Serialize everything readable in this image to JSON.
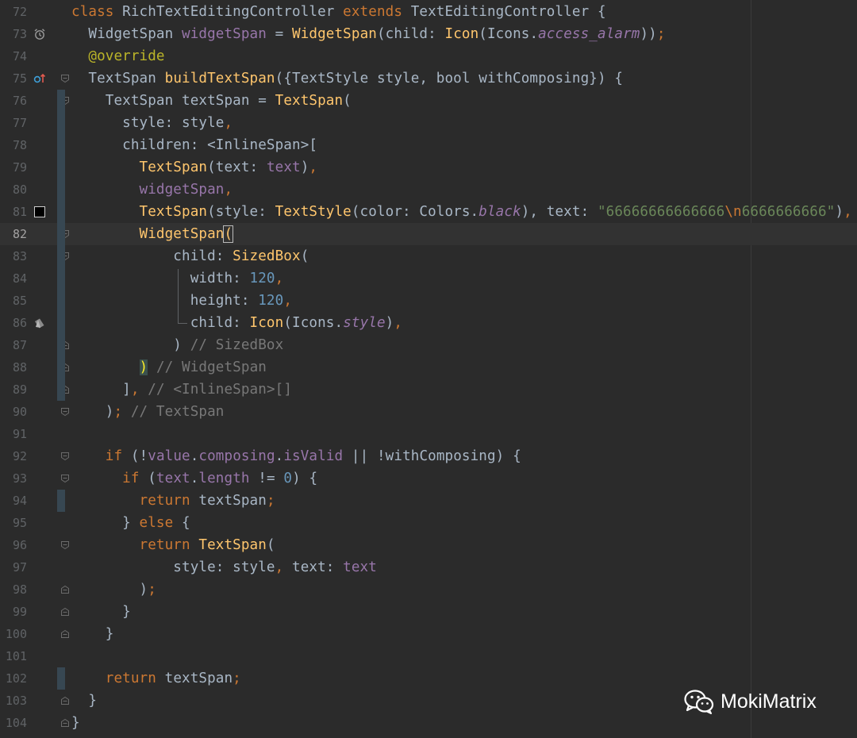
{
  "editor": {
    "lines": [
      {
        "num": "72",
        "tokens": [
          [
            "kw",
            "class "
          ],
          [
            "typ",
            "RichTextEditingController "
          ],
          [
            "kw",
            "extends "
          ],
          [
            "typ",
            "TextEditingController {"
          ]
        ]
      },
      {
        "num": "73",
        "tokens": [
          [
            "typ",
            "  WidgetSpan "
          ],
          [
            "fld",
            "widgetSpan"
          ],
          [
            "typ",
            " = "
          ],
          [
            "cls",
            "WidgetSpan"
          ],
          [
            "typ",
            "(child: "
          ],
          [
            "cls",
            "Icon"
          ],
          [
            "typ",
            "(Icons."
          ],
          [
            "ital",
            "access_alarm"
          ],
          [
            "typ",
            "))"
          ],
          [
            "kw",
            ";"
          ]
        ]
      },
      {
        "num": "74",
        "tokens": [
          [
            "ann",
            "  @override"
          ]
        ]
      },
      {
        "num": "75",
        "tokens": [
          [
            "typ",
            "  TextSpan "
          ],
          [
            "cls",
            "buildTextSpan"
          ],
          [
            "typ",
            "({TextStyle style, bool withComposing}) {"
          ]
        ]
      },
      {
        "num": "76",
        "tokens": [
          [
            "typ",
            "    TextSpan textSpan = "
          ],
          [
            "cls",
            "TextSpan"
          ],
          [
            "typ",
            "("
          ]
        ]
      },
      {
        "num": "77",
        "tokens": [
          [
            "typ",
            "      style: style"
          ],
          [
            "kw",
            ","
          ]
        ]
      },
      {
        "num": "78",
        "tokens": [
          [
            "typ",
            "      children: <InlineSpan>["
          ]
        ]
      },
      {
        "num": "79",
        "tokens": [
          [
            "cls",
            "        TextSpan"
          ],
          [
            "typ",
            "(text: "
          ],
          [
            "fld",
            "text"
          ],
          [
            "typ",
            ")"
          ],
          [
            "kw",
            ","
          ]
        ]
      },
      {
        "num": "80",
        "tokens": [
          [
            "fld",
            "        widgetSpan"
          ],
          [
            "kw",
            ","
          ]
        ]
      },
      {
        "num": "81",
        "tokens": [
          [
            "cls",
            "        TextSpan"
          ],
          [
            "typ",
            "(style: "
          ],
          [
            "cls",
            "TextStyle"
          ],
          [
            "typ",
            "(color: Colors."
          ],
          [
            "ital",
            "black"
          ],
          [
            "typ",
            "), text: "
          ],
          [
            "str",
            "\"66666666666666"
          ],
          [
            "esc",
            "\\n"
          ],
          [
            "str",
            "6666666666\""
          ],
          [
            "typ",
            ")"
          ],
          [
            "kw",
            ","
          ]
        ]
      },
      {
        "num": "82",
        "tokens": [
          [
            "cls",
            "        WidgetSpan"
          ],
          [
            "caret",
            "("
          ]
        ]
      },
      {
        "num": "83",
        "tokens": [
          [
            "typ",
            "            child: "
          ],
          [
            "cls",
            "SizedBox"
          ],
          [
            "typ",
            "("
          ]
        ]
      },
      {
        "num": "84",
        "tokens": [
          [
            "typ",
            "              width: "
          ],
          [
            "num",
            "120"
          ],
          [
            "kw",
            ","
          ]
        ]
      },
      {
        "num": "85",
        "tokens": [
          [
            "typ",
            "              height: "
          ],
          [
            "num",
            "120"
          ],
          [
            "kw",
            ","
          ]
        ]
      },
      {
        "num": "86",
        "tokens": [
          [
            "typ",
            "              child: "
          ],
          [
            "cls",
            "Icon"
          ],
          [
            "typ",
            "(Icons."
          ],
          [
            "ital",
            "style"
          ],
          [
            "typ",
            ")"
          ],
          [
            "kw",
            ","
          ]
        ]
      },
      {
        "num": "87",
        "tokens": [
          [
            "typ",
            "            ) "
          ],
          [
            "inlay",
            "// SizedBox"
          ]
        ]
      },
      {
        "num": "88",
        "tokens": [
          [
            "typ",
            "        "
          ],
          [
            "match",
            ")"
          ],
          [
            "typ",
            " "
          ],
          [
            "inlay",
            "// WidgetSpan"
          ]
        ]
      },
      {
        "num": "89",
        "tokens": [
          [
            "typ",
            "      ]"
          ],
          [
            "kw",
            ", "
          ],
          [
            "inlay",
            "// <InlineSpan>[]"
          ]
        ]
      },
      {
        "num": "90",
        "tokens": [
          [
            "typ",
            "    )"
          ],
          [
            "kw",
            "; "
          ],
          [
            "inlay",
            "// TextSpan"
          ]
        ]
      },
      {
        "num": "91",
        "tokens": []
      },
      {
        "num": "92",
        "tokens": [
          [
            "kw",
            "    if "
          ],
          [
            "typ",
            "(!"
          ],
          [
            "fld",
            "value"
          ],
          [
            "typ",
            "."
          ],
          [
            "fld",
            "composing"
          ],
          [
            "typ",
            "."
          ],
          [
            "fld",
            "isValid"
          ],
          [
            "typ",
            " || !withComposing) {"
          ]
        ]
      },
      {
        "num": "93",
        "tokens": [
          [
            "kw",
            "      if "
          ],
          [
            "typ",
            "("
          ],
          [
            "fld",
            "text"
          ],
          [
            "typ",
            "."
          ],
          [
            "fld",
            "length"
          ],
          [
            "typ",
            " != "
          ],
          [
            "num",
            "0"
          ],
          [
            "typ",
            ") {"
          ]
        ]
      },
      {
        "num": "94",
        "tokens": [
          [
            "kw",
            "        return "
          ],
          [
            "typ",
            "textSpan"
          ],
          [
            "kw",
            ";"
          ]
        ]
      },
      {
        "num": "95",
        "tokens": [
          [
            "typ",
            "      } "
          ],
          [
            "kw",
            "else "
          ],
          [
            "typ",
            "{"
          ]
        ]
      },
      {
        "num": "96",
        "tokens": [
          [
            "kw",
            "        return "
          ],
          [
            "cls",
            "TextSpan"
          ],
          [
            "typ",
            "("
          ]
        ]
      },
      {
        "num": "97",
        "tokens": [
          [
            "typ",
            "            style: style"
          ],
          [
            "kw",
            ", "
          ],
          [
            "typ",
            "text: "
          ],
          [
            "fld",
            "text"
          ]
        ]
      },
      {
        "num": "98",
        "tokens": [
          [
            "typ",
            "        )"
          ],
          [
            "kw",
            ";"
          ]
        ]
      },
      {
        "num": "99",
        "tokens": [
          [
            "typ",
            "      }"
          ]
        ]
      },
      {
        "num": "100",
        "tokens": [
          [
            "typ",
            "    }"
          ]
        ]
      },
      {
        "num": "101",
        "tokens": []
      },
      {
        "num": "102",
        "tokens": [
          [
            "kw",
            "    return "
          ],
          [
            "typ",
            "textSpan"
          ],
          [
            "kw",
            ";"
          ]
        ]
      },
      {
        "num": "103",
        "tokens": [
          [
            "typ",
            "  }"
          ]
        ]
      },
      {
        "num": "104",
        "tokens": [
          [
            "typ",
            "}"
          ]
        ]
      }
    ]
  },
  "gutter_icons": {
    "73": "alarm-icon",
    "75": "override-method-icon",
    "81": "color-swatch-icon",
    "86": "style-icon"
  },
  "watermark": {
    "text": "MokiMatrix",
    "icon": "wechat-icon"
  },
  "colors": {
    "background": "#2b2b2b",
    "keyword": "#cc7832",
    "function": "#ffc66d",
    "field": "#9876aa",
    "number": "#6897bb",
    "string": "#6a8759",
    "comment": "#808080",
    "annotation": "#bbb529"
  }
}
